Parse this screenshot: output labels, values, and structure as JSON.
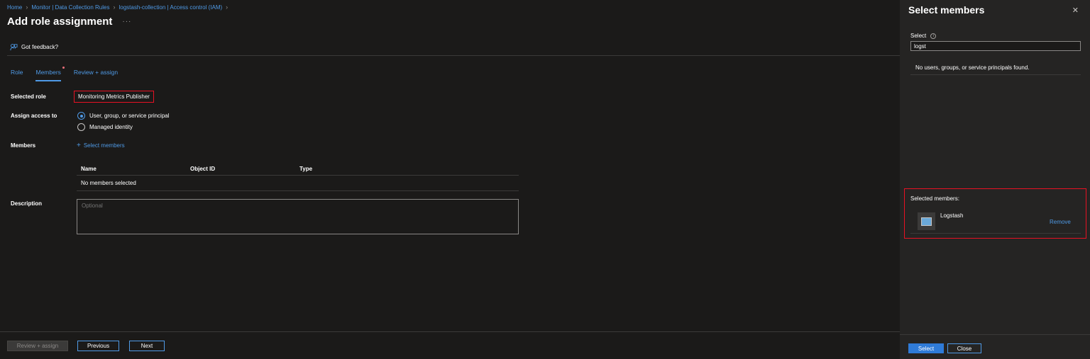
{
  "breadcrumb": {
    "items": [
      "Home",
      "Monitor | Data Collection Rules",
      "logstash-collection | Access control (IAM)"
    ]
  },
  "page": {
    "title": "Add role assignment",
    "more": "···",
    "feedback": "Got feedback?"
  },
  "tabs": [
    "Role",
    "Members",
    "Review + assign"
  ],
  "form": {
    "selected_role_label": "Selected role",
    "selected_role_value": "Monitoring Metrics Publisher",
    "assign_access_label": "Assign access to",
    "assign_options": [
      "User, group, or service principal",
      "Managed identity"
    ],
    "members_label": "Members",
    "select_members_link": "Select members",
    "description_label": "Description",
    "description_placeholder": "Optional"
  },
  "members_table": {
    "headers": [
      "Name",
      "Object ID",
      "Type"
    ],
    "empty_text": "No members selected"
  },
  "footer": {
    "review_assign": "Review + assign",
    "previous": "Previous",
    "next": "Next"
  },
  "panel": {
    "title": "Select members",
    "close": "✕",
    "select_label": "Select",
    "search_value": "logst",
    "no_results": "No users, groups, or service principals found.",
    "selected_heading": "Selected members:",
    "selected_member_name": "Logstash",
    "remove": "Remove",
    "select_button": "Select",
    "close_button": "Close"
  },
  "colors": {
    "accent": "#4f9ae6",
    "highlight_border": "#e81123",
    "background": "#1b1a19",
    "panel_background": "#252423"
  }
}
